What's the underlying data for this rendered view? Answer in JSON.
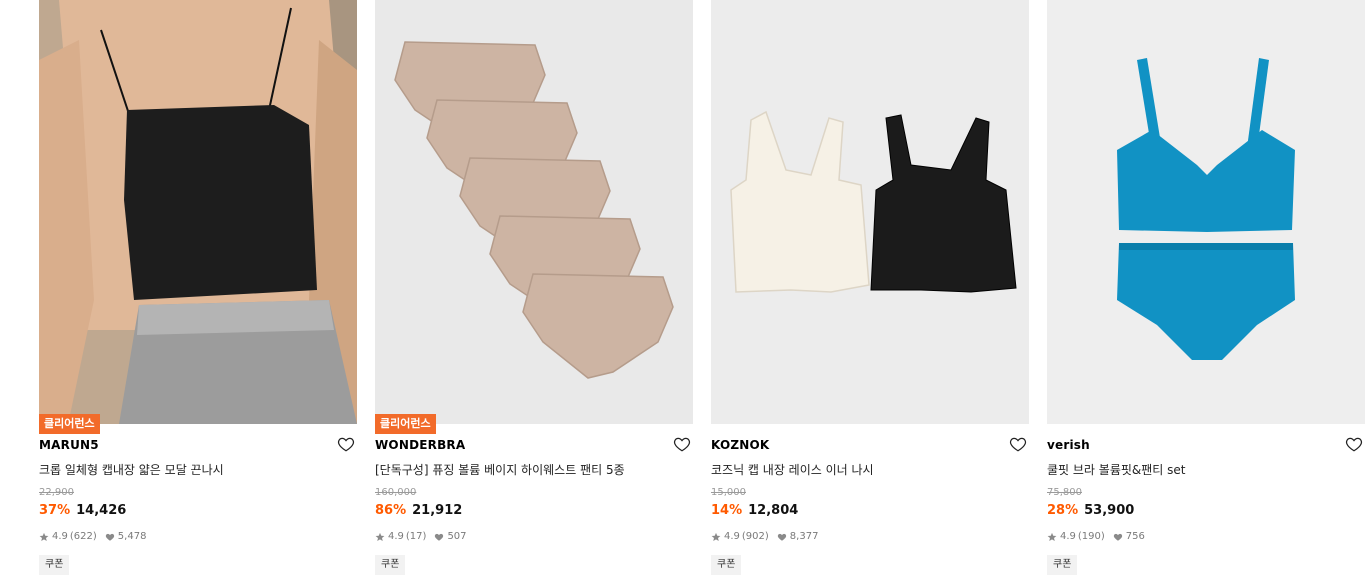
{
  "products": [
    {
      "badge": "클리어런스",
      "brand": "MARUN5",
      "name": "크롭 일체형 캡내장 얇은 모달 끈나시",
      "original_price": "22,900",
      "discount": "37%",
      "price": "14,426",
      "rating": "4.9",
      "reviews": "(622)",
      "likes": "5,478",
      "coupon": "쿠폰",
      "image": "model-black-crop-camisole"
    },
    {
      "badge": "클리어런스",
      "brand": "WONDERBRA",
      "name": "[단독구성] 퓨징 볼륨 베이지 하이웨스트 팬티 5종",
      "original_price": "160,000",
      "discount": "86%",
      "price": "21,912",
      "rating": "4.9",
      "reviews": "(17)",
      "likes": "507",
      "coupon": "쿠폰",
      "image": "beige-briefs-stack"
    },
    {
      "badge": "",
      "brand": "KOZNOK",
      "name": "코즈닉 캡 내장 레이스 이너 나시",
      "original_price": "15,000",
      "discount": "14%",
      "price": "12,804",
      "rating": "4.9",
      "reviews": "(902)",
      "likes": "8,377",
      "coupon": "쿠폰",
      "image": "ivory-black-lace-camisoles"
    },
    {
      "badge": "",
      "brand": "verish",
      "name": "쿨핏 브라 볼륨핏&팬티 set",
      "original_price": "75,800",
      "discount": "28%",
      "price": "53,900",
      "rating": "4.9",
      "reviews": "(190)",
      "likes": "756",
      "coupon": "쿠폰",
      "image": "blue-bra-panty-set"
    }
  ],
  "colors": {
    "discount": "#ff5a00",
    "badge": "#f26b2a",
    "product_blue": "#1192c4",
    "beige": "#cdb4a3"
  },
  "icons": [
    "heart-outline-icon",
    "star-icon",
    "heart-filled-icon"
  ]
}
